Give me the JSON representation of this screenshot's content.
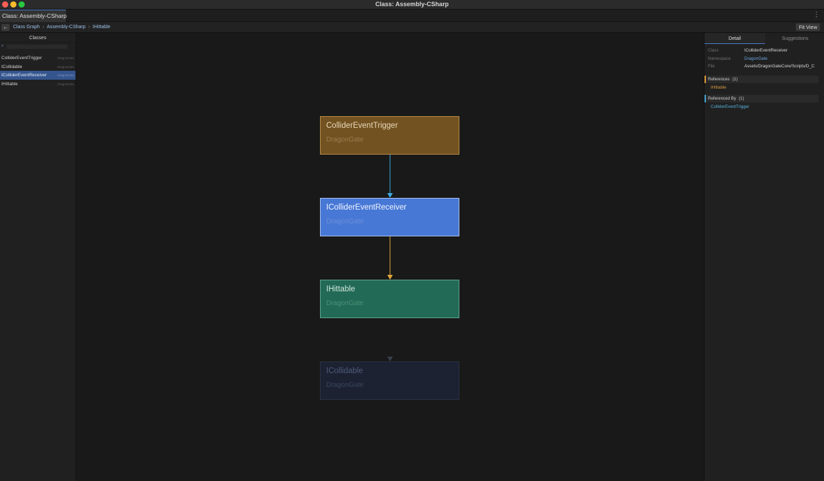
{
  "window": {
    "title": "Class: Assembly-CSharp"
  },
  "tab": {
    "label": "Class: Assembly-CSharp",
    "menu_icon": "⋮"
  },
  "breadcrumb": {
    "back_icon": "arrow-left-icon",
    "items": [
      "Class Graph",
      "Assembly-CSharp",
      "IHittable"
    ],
    "separator": "›"
  },
  "toolbar": {
    "fit_view_label": "Fit View"
  },
  "sidebar": {
    "header": "Classes",
    "search": {
      "value": "",
      "placeholder": ""
    },
    "items": [
      {
        "name": "ColliderEventTrigger",
        "namespace": "DragonGate",
        "selected": false
      },
      {
        "name": "ICollidable",
        "namespace": "DragonGate",
        "selected": false
      },
      {
        "name": "IColliderEventReceiver",
        "namespace": "DragonGate",
        "selected": true
      },
      {
        "name": "IHittable",
        "namespace": "DragonGate",
        "selected": false
      }
    ]
  },
  "graph": {
    "nodes": [
      {
        "title": "ColliderEventTrigger",
        "namespace": "DragonGate",
        "color": "#725220"
      },
      {
        "title": "IColliderEventReceiver",
        "namespace": "DragonGate",
        "color": "#4878d6"
      },
      {
        "title": "IHittable",
        "namespace": "DragonGate",
        "color": "#226a55"
      },
      {
        "title": "ICollidable",
        "namespace": "DragonGate",
        "color": "#1c2232"
      }
    ],
    "edge_colors": {
      "referenced_by": "#3ba9e0",
      "references": "#e0a83a",
      "faded": "#3a3f4d"
    }
  },
  "detail": {
    "tabs": [
      "Detail",
      "Suggestions"
    ],
    "class_key": "Class",
    "class_value": "IColliderEventReceiver",
    "namespace_key": "Namespace",
    "namespace_value": "DragonGate",
    "file_key": "File",
    "file_value": "Assets/DragonGateCore/Scripts/D_C",
    "references_label": "References",
    "references_count": "(1)",
    "references": [
      "IHittable"
    ],
    "referenced_by_label": "Referenced By",
    "referenced_by_count": "(1)",
    "referenced_by": [
      "ColliderEventTrigger"
    ]
  }
}
